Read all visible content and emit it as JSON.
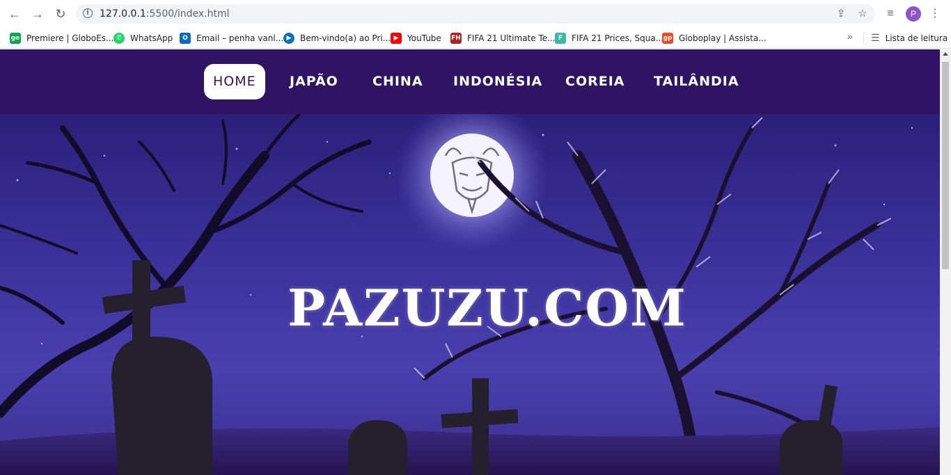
{
  "browser": {
    "url_host": "127.0.0.1",
    "url_rest": ":5500/index.html",
    "profile_initial": "P",
    "bookmarks": [
      {
        "label": "Premiere | GloboEs...",
        "icon": "ge-icon",
        "color": "#06aa48",
        "glyph": "ge"
      },
      {
        "label": "WhatsApp",
        "icon": "whatsapp-icon",
        "color": "#25d366",
        "glyph": "✆"
      },
      {
        "label": "Email – penha vanl...",
        "icon": "outlook-icon",
        "color": "#0f6cbd",
        "glyph": "O"
      },
      {
        "label": "Bem-vindo(a) ao Pri...",
        "icon": "prime-icon",
        "color": "#146eb4",
        "glyph": "▶"
      },
      {
        "label": "YouTube",
        "icon": "youtube-icon",
        "color": "#ff0000",
        "glyph": "▶"
      },
      {
        "label": "FIFA 21 Ultimate Te...",
        "icon": "futhead-icon",
        "color": "#b41f24",
        "glyph": "FH"
      },
      {
        "label": "FIFA 21 Prices, Squa...",
        "icon": "futbin-icon",
        "color": "#3cb9a3",
        "glyph": "F"
      },
      {
        "label": "Globoplay | Assista...",
        "icon": "globoplay-icon",
        "color": "#f6461d",
        "glyph": "gp"
      }
    ],
    "reading_list": "Lista de leitura"
  },
  "site": {
    "menu": [
      {
        "label": "HOME",
        "active": true
      },
      {
        "label": "JAPÃO",
        "active": false
      },
      {
        "label": "CHINA",
        "active": false
      },
      {
        "label": "INDONÉSIA",
        "active": false
      },
      {
        "label": "COREIA",
        "active": false
      },
      {
        "label": "TAILÂNDIA",
        "active": false
      }
    ],
    "title": "PAZUZU.COM",
    "nav_color": "#2e1463"
  }
}
